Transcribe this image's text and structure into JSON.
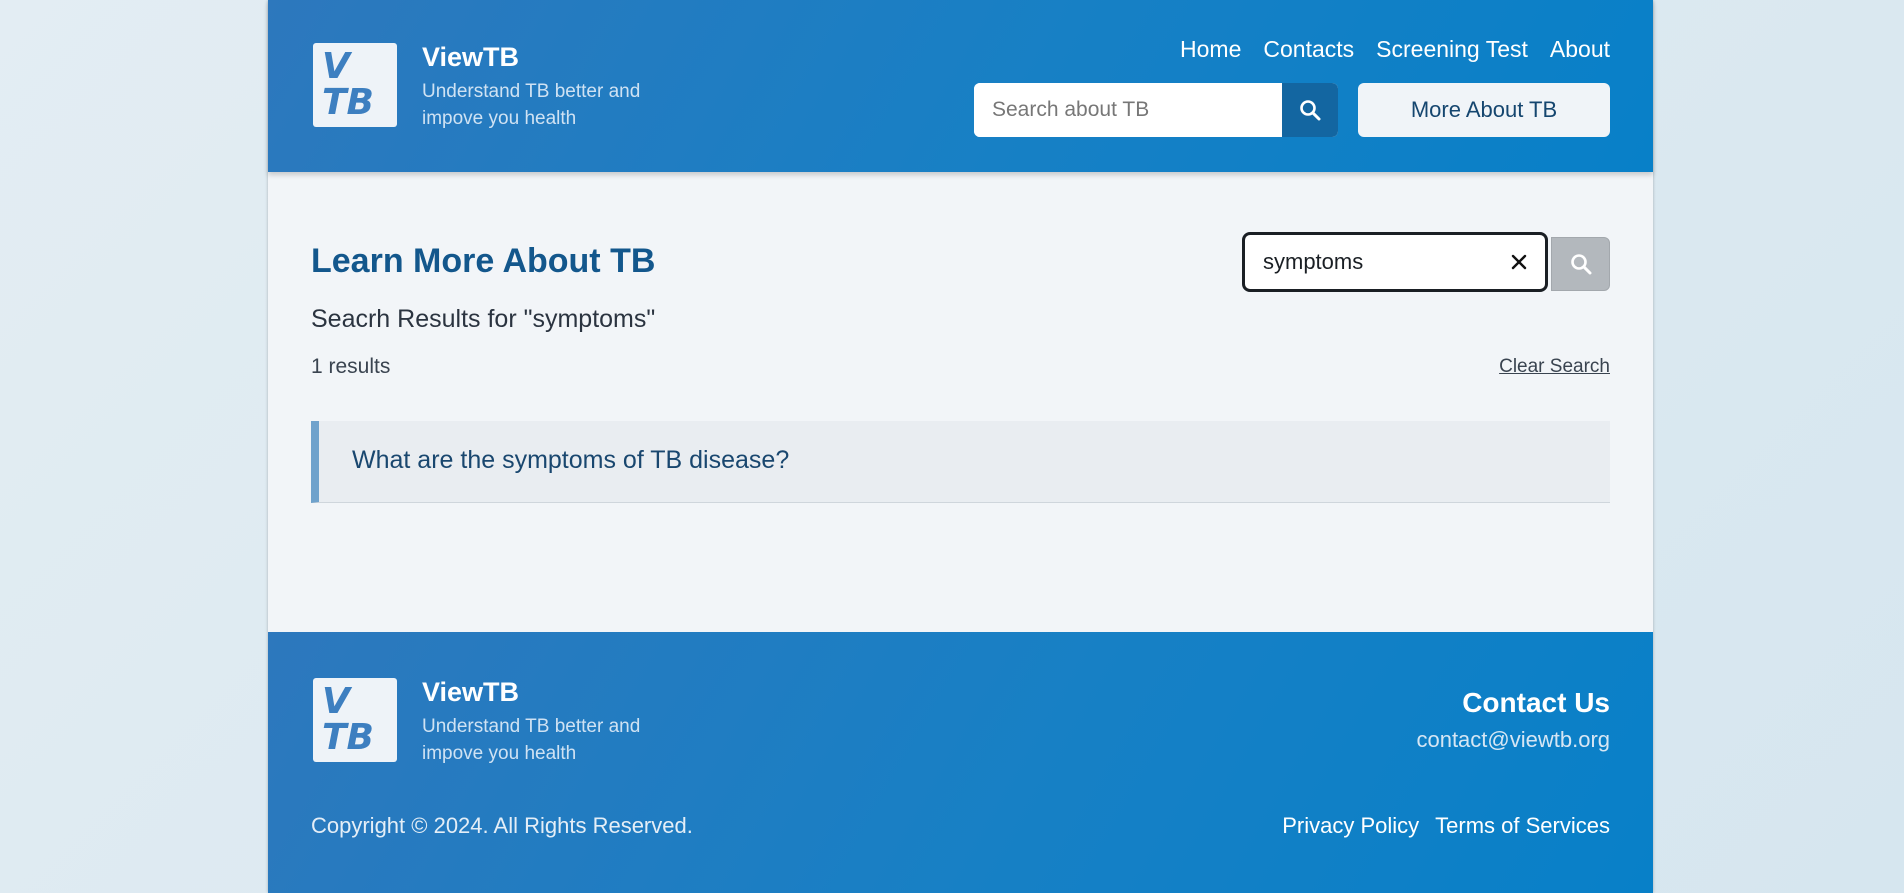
{
  "brand": {
    "logo_line1": "V",
    "logo_line2": "TB",
    "name": "ViewTB",
    "tagline": "Understand TB better and impove you health"
  },
  "nav": {
    "items": [
      "Home",
      "Contacts",
      "Screening Test",
      "About"
    ]
  },
  "header_search": {
    "placeholder": "Search about TB",
    "icon": "search-icon"
  },
  "more_button": {
    "label": "More About TB"
  },
  "main": {
    "title": "Learn More About TB",
    "search_value": "symptoms",
    "results_heading": "Seacrh Results for \"symptoms\"",
    "results_count": "1 results",
    "clear_label": "Clear Search",
    "results": [
      {
        "title": "What are the symptoms of TB disease?"
      }
    ]
  },
  "footer": {
    "contact_title": "Contact Us",
    "contact_email": "contact@viewtb.org",
    "copyright": "Copyright © 2024. All Rights Reserved.",
    "links": [
      "Privacy Policy",
      "Terms of Services"
    ]
  },
  "colors": {
    "brand_blue": "#1780c5",
    "title_blue": "#13578c",
    "search_button": "#1366a1",
    "result_accent": "#6fa2cc"
  }
}
